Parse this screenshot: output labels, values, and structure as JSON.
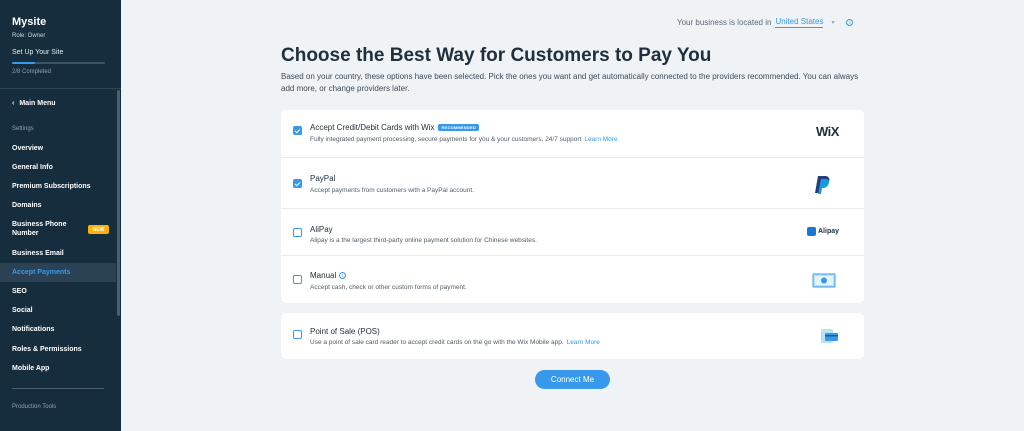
{
  "sidebar": {
    "site_name": "Mysite",
    "role": "Role: Owner",
    "setup_label": "Set Up Your Site",
    "progress": 0.25,
    "completed": "2/8 Completed",
    "back_label": "Main Menu",
    "section_settings": "Settings",
    "items": [
      {
        "label": "Overview"
      },
      {
        "label": "General Info"
      },
      {
        "label": "Premium Subscriptions"
      },
      {
        "label": "Domains"
      },
      {
        "label": "Business Phone Number",
        "badge": "NEW"
      },
      {
        "label": "Business Email"
      },
      {
        "label": "Accept Payments",
        "active": true
      },
      {
        "label": "SEO"
      },
      {
        "label": "Social"
      },
      {
        "label": "Notifications"
      },
      {
        "label": "Roles & Permissions"
      },
      {
        "label": "Mobile App"
      }
    ],
    "section_production": "Production Tools"
  },
  "location": {
    "prefix": "Your business is located in",
    "country": "United States"
  },
  "page": {
    "title": "Choose the Best Way for Customers to Pay You",
    "subtitle": "Based on your country, these options have been selected. Pick the ones you want and get automatically connected to the providers recommended. You can always add more, or change providers later."
  },
  "methods": [
    {
      "title": "Accept Credit/Debit Cards with Wix",
      "badge": "RECOMMENDED",
      "desc": "Fully integrated payment processing, secure payments for you & your customers, 24/7 support",
      "link": "Learn More",
      "checked": true,
      "logo": "WiX",
      "icon": "wix-logo-icon"
    },
    {
      "title": "PayPal",
      "desc": "Accept payments from customers with a PayPal account.",
      "checked": true,
      "icon": "paypal-logo-icon"
    },
    {
      "title": "AliPay",
      "desc": "Alipay is a the largest third-party online payment solution for Chinese websites.",
      "checked": false,
      "logo": "Alipay",
      "icon": "alipay-logo-icon"
    },
    {
      "title": "Manual",
      "desc": "Accept cash, check or other custom forms of payment.",
      "checked": false,
      "icon": "cash-icon"
    }
  ],
  "pos": {
    "title": "Point of Sale (POS)",
    "desc": "Use a point of sale card reader to accept credit cards on the go with the Wix Mobile app.",
    "link": "Learn More",
    "checked": false,
    "icon": "card-reader-icon"
  },
  "connect_label": "Connect Me",
  "colors": {
    "accent": "#3899ec",
    "sidebar": "#162d3d",
    "badge_new": "#fdb10c",
    "background": "#f0f3f6"
  }
}
